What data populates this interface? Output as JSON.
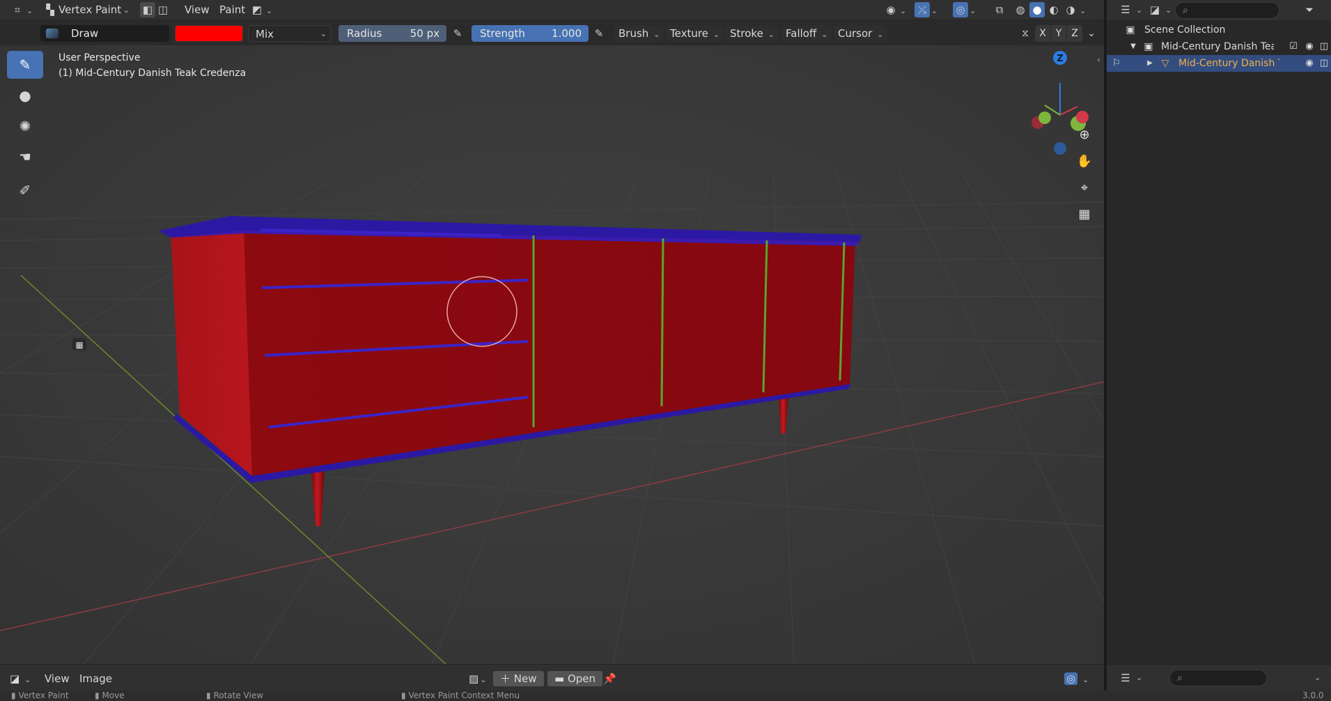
{
  "header": {
    "editor_type_icon": "3d-viewport-icon",
    "mode": {
      "icon": "vertex-paint-icon",
      "label": "Vertex Paint"
    },
    "menus": [
      "View",
      "Paint"
    ],
    "mask_icon": "face-mask-icon",
    "right_icons": [
      "visibility-icon",
      "gizmo-icon",
      "overlay-icon",
      "xray-icon",
      "wireframe-shading-icon",
      "solid-shading-icon",
      "material-shading-icon",
      "rendered-shading-icon"
    ]
  },
  "toolbar": {
    "brush": "Draw",
    "color": "#ff0000",
    "blend": "Mix",
    "radius": {
      "label": "Radius",
      "value": "50 px"
    },
    "strength": {
      "label": "Strength",
      "value": "1.000"
    },
    "menus": [
      "Brush",
      "Texture",
      "Stroke",
      "Falloff",
      "Cursor"
    ],
    "axes": [
      "X",
      "Y",
      "Z"
    ]
  },
  "viewport": {
    "view_name": "User Perspective",
    "object_name": "(1) Mid-Century Danish Teak Credenza",
    "tools": [
      {
        "name": "draw-tool",
        "icon": "brush-icon",
        "glyph": "✎",
        "active": true
      },
      {
        "name": "blur-tool",
        "icon": "drop-icon",
        "glyph": "●",
        "active": false
      },
      {
        "name": "average-tool",
        "icon": "average-icon",
        "glyph": "✺",
        "active": false
      },
      {
        "name": "smear-tool",
        "icon": "smear-icon",
        "glyph": "☚",
        "active": false
      },
      {
        "name": "annotate-tool",
        "icon": "annotate-icon",
        "glyph": "✐",
        "active": false
      }
    ],
    "gizmo": {
      "z_label": "Z"
    },
    "nav_buttons": [
      {
        "name": "zoom-button",
        "icon": "zoom-icon",
        "glyph": "⊕"
      },
      {
        "name": "pan-button",
        "icon": "hand-icon",
        "glyph": "✋"
      },
      {
        "name": "camera-view-button",
        "icon": "camera-icon",
        "glyph": "⌖"
      },
      {
        "name": "ortho-toggle-button",
        "icon": "grid-icon",
        "glyph": "▦"
      }
    ],
    "brush_color": "#ff0000"
  },
  "outliner": {
    "rows": [
      {
        "label": "Scene Collection",
        "icon": "collection-icon",
        "selected": false
      },
      {
        "label": "Mid-Century Danish Teak C",
        "icon": "collection-icon",
        "selected": false
      },
      {
        "label": "Mid-Century Danish Te",
        "icon": "mesh-object-icon",
        "selected": true
      }
    ]
  },
  "image_editor": {
    "menus": [
      "View",
      "Image"
    ],
    "new_label": "New",
    "open_label": "Open"
  },
  "statusbar": {
    "items": [
      "Vertex Paint",
      "Move",
      "Rotate View",
      "Vertex Paint Context Menu"
    ],
    "version": "3.0.0"
  }
}
